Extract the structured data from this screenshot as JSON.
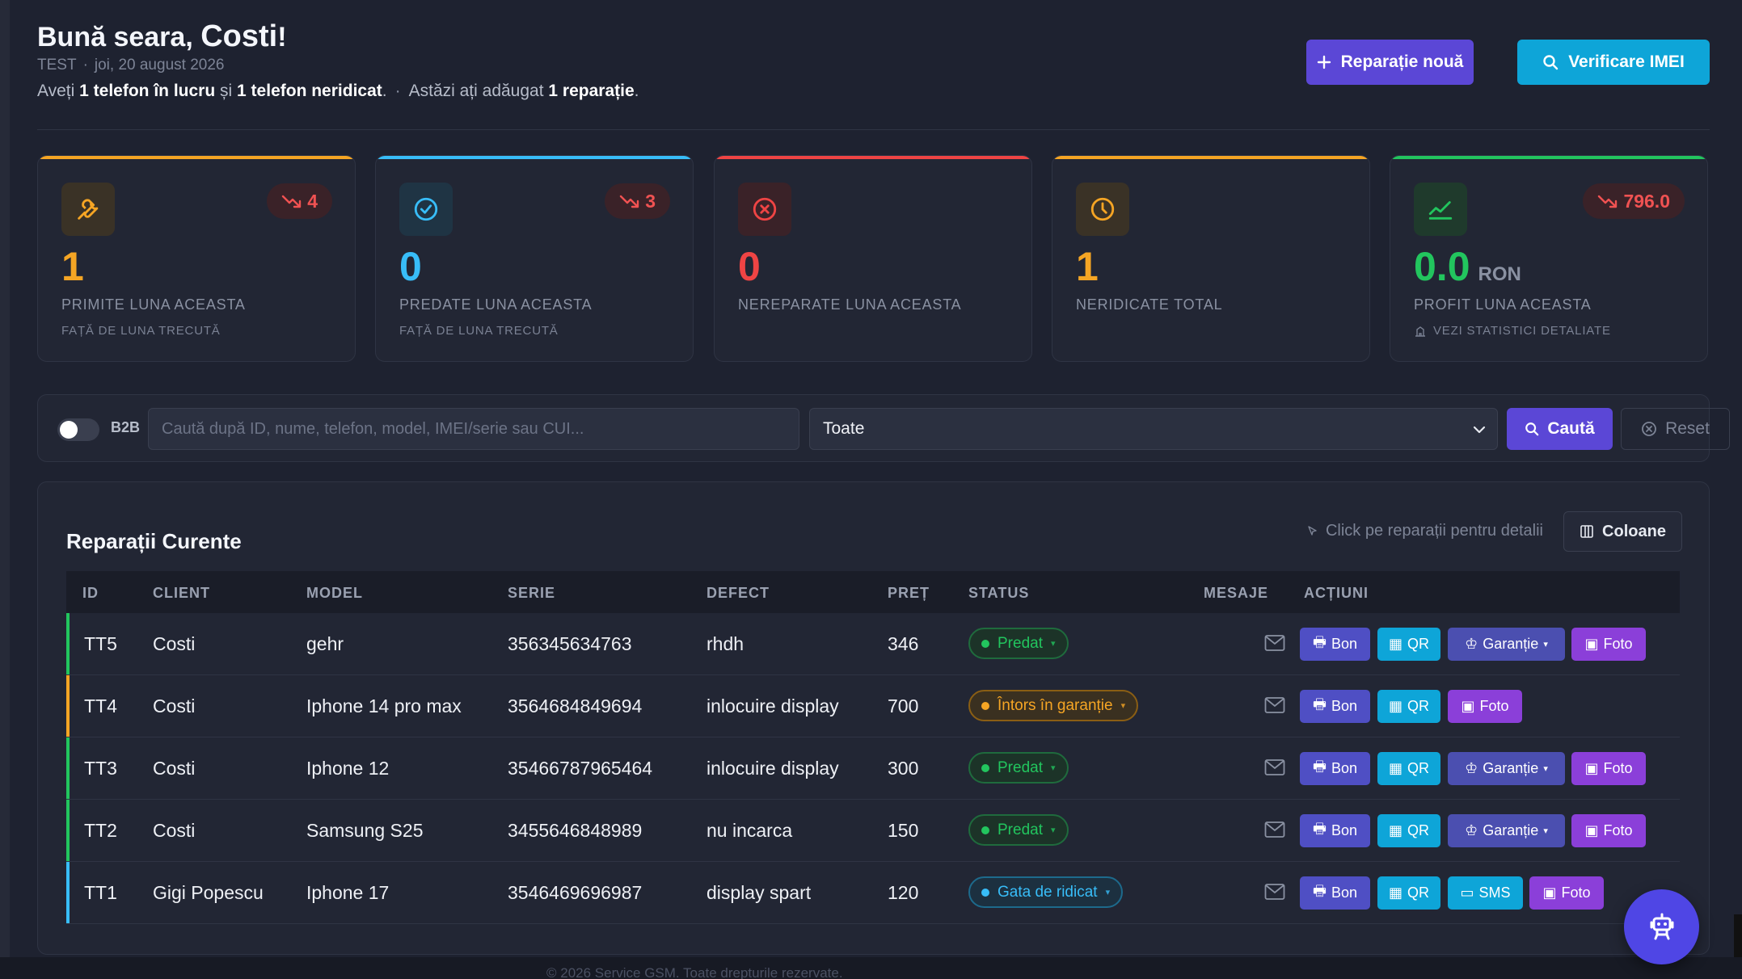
{
  "header": {
    "greeting": "Bună seara,",
    "user_name": "Costi",
    "exclamation": "!",
    "env": "TEST",
    "date": "joi, 20 august 2026",
    "info_prefix": "Aveți",
    "info_working": "1 telefon în lucru",
    "info_and": "și",
    "info_uncollected": "1 telefon neridicat",
    "info_today_prefix": "Astăzi ați adăugat",
    "info_today_count": "1 reparație"
  },
  "actions": {
    "new_repair": "Reparație nouă",
    "check_imei": "Verificare IMEI"
  },
  "stats": [
    {
      "value": "1",
      "label": "PRIMITE LUNA ACEASTA",
      "sub": "FAȚĂ DE LUNA TRECUTĂ",
      "trend": "4",
      "color": "#f5a524",
      "icon": "wrench-icon"
    },
    {
      "value": "0",
      "label": "PREDATE LUNA ACEASTA",
      "sub": "FAȚĂ DE LUNA TRECUTĂ",
      "trend": "3",
      "color": "#38bdf8",
      "icon": "check-circle-icon"
    },
    {
      "value": "0",
      "label": "NEREPARATE LUNA ACEASTA",
      "sub": "",
      "trend": "",
      "color": "#ef4444",
      "icon": "x-circle-icon"
    },
    {
      "value": "1",
      "label": "NERIDICATE TOTAL",
      "sub": "",
      "trend": "",
      "color": "#f5a524",
      "icon": "clock-icon"
    },
    {
      "value": "0.0",
      "unit": "RON",
      "label": "PROFIT LUNA ACEASTA",
      "sub": "VEZI STATISTICI DETALIATE",
      "trend": "796.0",
      "color": "#22c55e",
      "icon": "chart-line-icon"
    }
  ],
  "search": {
    "b2b_label": "B2B",
    "placeholder": "Caută după ID, nume, telefon, model, IMEI/serie sau CUI...",
    "status_selected": "Toate",
    "search_label": "Caută",
    "reset_label": "Reset"
  },
  "table": {
    "title": "Reparații Curente",
    "hint": "Click pe reparații pentru detalii",
    "columns_label": "Coloane",
    "headers": [
      "ID",
      "CLIENT",
      "MODEL",
      "SERIE",
      "DEFECT",
      "PREȚ",
      "STATUS",
      "MESAJE",
      "ACȚIUNI"
    ],
    "rows": [
      {
        "id": "TT5",
        "client": "Costi",
        "model": "gehr",
        "serie": "356345634763",
        "defect": "rhdh",
        "pret": "346",
        "status": "Predat",
        "status_color": "#22c55e",
        "extra": "Garanție"
      },
      {
        "id": "TT4",
        "client": "Costi",
        "model": "Iphone 14 pro max",
        "serie": "3564684849694",
        "defect": "inlocuire display",
        "pret": "700",
        "status": "Întors în garanție",
        "status_color": "#f5a524",
        "extra": ""
      },
      {
        "id": "TT3",
        "client": "Costi",
        "model": "Iphone 12",
        "serie": "35466787965464",
        "defect": "inlocuire display",
        "pret": "300",
        "status": "Predat",
        "status_color": "#22c55e",
        "extra": "Garanție"
      },
      {
        "id": "TT2",
        "client": "Costi",
        "model": "Samsung S25",
        "serie": "3455646848989",
        "defect": "nu incarca",
        "pret": "150",
        "status": "Predat",
        "status_color": "#22c55e",
        "extra": "Garanție"
      },
      {
        "id": "TT1",
        "client": "Gigi Popescu",
        "model": "Iphone 17",
        "serie": "3546469696987",
        "defect": "display spart",
        "pret": "120",
        "status": "Gata de ridicat",
        "status_color": "#38bdf8",
        "extra": "SMS"
      }
    ],
    "btn_bon": "Bon",
    "btn_qr": "QR",
    "btn_foto": "Foto"
  },
  "footer": "© 2026 Service GSM. Toate drepturile rezervate."
}
